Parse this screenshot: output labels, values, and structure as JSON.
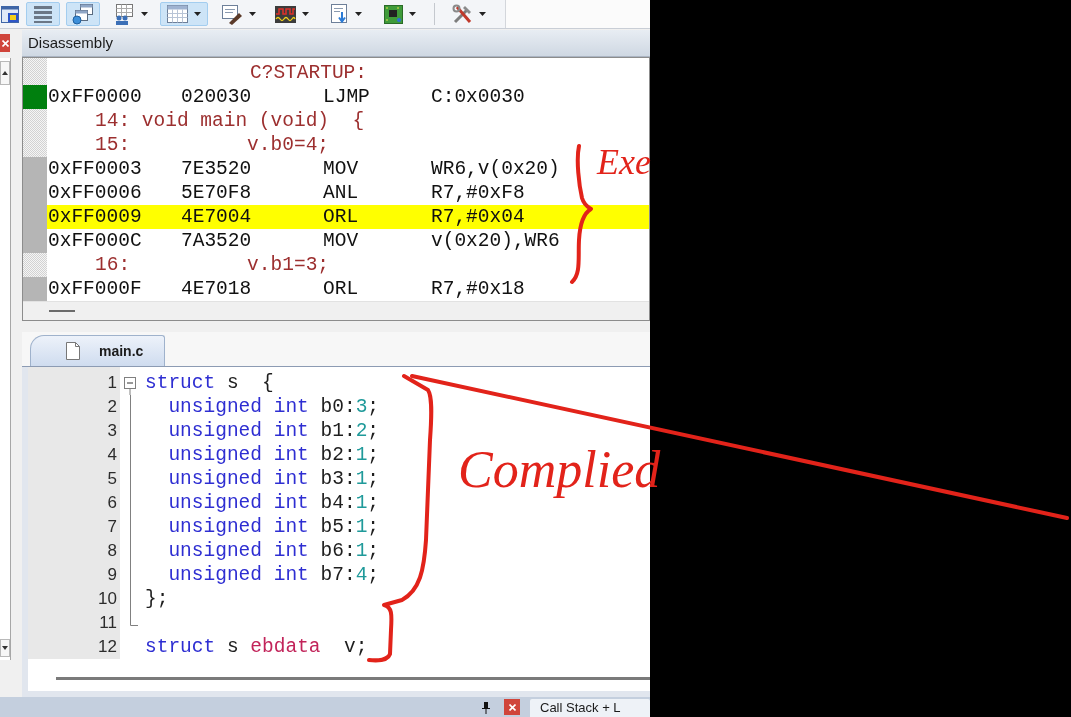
{
  "toolbar": {
    "items": [
      {
        "kind": "button",
        "on": false,
        "dropdown": false
      },
      {
        "kind": "button",
        "on": true,
        "dropdown": false
      },
      {
        "kind": "button",
        "on": true,
        "dropdown": false
      },
      {
        "kind": "button",
        "on": false,
        "dropdown": true
      },
      {
        "kind": "button",
        "on": true,
        "dropdown": true
      },
      {
        "kind": "button",
        "on": false,
        "dropdown": true
      },
      {
        "kind": "button",
        "on": false,
        "dropdown": true
      },
      {
        "kind": "button",
        "on": false,
        "dropdown": true
      },
      {
        "kind": "button",
        "on": false,
        "dropdown": true
      },
      {
        "kind": "separator"
      },
      {
        "kind": "button",
        "on": false,
        "dropdown": true
      }
    ]
  },
  "disassembly": {
    "title": "Disassembly",
    "rows": [
      {
        "kind": "label",
        "text": "C?STARTUP:"
      },
      {
        "kind": "instruction",
        "address": "0xFF0000",
        "opcode": "020030",
        "mnemonic": "LJMP",
        "operands": "C:0x0030",
        "color": "#007f0e",
        "highlighted": false
      },
      {
        "kind": "source",
        "text": "14: void main (void)  {"
      },
      {
        "kind": "source",
        "text": "15:          v.b0=4;"
      },
      {
        "kind": "instruction",
        "address": "0xFF0003",
        "opcode": "7E3520",
        "mnemonic": "MOV",
        "operands": "WR6,v(0x20)",
        "color": "#b5b5b5",
        "highlighted": false
      },
      {
        "kind": "instruction",
        "address": "0xFF0006",
        "opcode": "5E70F8",
        "mnemonic": "ANL",
        "operands": "R7,#0xF8",
        "color": "#b5b5b5",
        "highlighted": false
      },
      {
        "kind": "instruction",
        "address": "0xFF0009",
        "opcode": "4E7004",
        "mnemonic": "ORL",
        "operands": "R7,#0x04",
        "color": "#b5b5b5",
        "highlighted": true
      },
      {
        "kind": "instruction",
        "address": "0xFF000C",
        "opcode": "7A3520",
        "mnemonic": "MOV",
        "operands": "v(0x20),WR6",
        "color": "#b5b5b5",
        "highlighted": false
      },
      {
        "kind": "source",
        "text": "16:          v.b1=3;"
      },
      {
        "kind": "instruction",
        "address": "0xFF000F",
        "opcode": "4E7018",
        "mnemonic": "ORL",
        "operands": "R7,#0x18",
        "color": "#b5b5b5",
        "highlighted": false
      }
    ]
  },
  "editor": {
    "tab": {
      "label": "main.c",
      "selected": true
    },
    "lines": [
      {
        "number": "1",
        "kind": "fold_start",
        "indented": false,
        "tokens": [
          {
            "kind": "keyword",
            "text": "struct"
          },
          {
            "kind": "plain",
            "text": " s  {"
          }
        ]
      },
      {
        "number": "2",
        "kind": "fold_body",
        "indented": true,
        "tokens": [
          {
            "kind": "keyword",
            "text": "unsigned int"
          },
          {
            "kind": "plain",
            "text": " b0:"
          },
          {
            "kind": "number",
            "text": "3"
          },
          {
            "kind": "plain",
            "text": ";"
          }
        ]
      },
      {
        "number": "3",
        "kind": "fold_body",
        "indented": true,
        "tokens": [
          {
            "kind": "keyword",
            "text": "unsigned int"
          },
          {
            "kind": "plain",
            "text": " b1:"
          },
          {
            "kind": "number",
            "text": "2"
          },
          {
            "kind": "plain",
            "text": ";"
          }
        ]
      },
      {
        "number": "4",
        "kind": "fold_body",
        "indented": true,
        "tokens": [
          {
            "kind": "keyword",
            "text": "unsigned int"
          },
          {
            "kind": "plain",
            "text": " b2:"
          },
          {
            "kind": "number",
            "text": "1"
          },
          {
            "kind": "plain",
            "text": ";"
          }
        ]
      },
      {
        "number": "5",
        "kind": "fold_body",
        "indented": true,
        "tokens": [
          {
            "kind": "keyword",
            "text": "unsigned int"
          },
          {
            "kind": "plain",
            "text": " b3:"
          },
          {
            "kind": "number",
            "text": "1"
          },
          {
            "kind": "plain",
            "text": ";"
          }
        ]
      },
      {
        "number": "6",
        "kind": "fold_body",
        "indented": true,
        "tokens": [
          {
            "kind": "keyword",
            "text": "unsigned int"
          },
          {
            "kind": "plain",
            "text": " b4:"
          },
          {
            "kind": "number",
            "text": "1"
          },
          {
            "kind": "plain",
            "text": ";"
          }
        ]
      },
      {
        "number": "7",
        "kind": "fold_body",
        "indented": true,
        "tokens": [
          {
            "kind": "keyword",
            "text": "unsigned int"
          },
          {
            "kind": "plain",
            "text": " b5:"
          },
          {
            "kind": "number",
            "text": "1"
          },
          {
            "kind": "plain",
            "text": ";"
          }
        ]
      },
      {
        "number": "8",
        "kind": "fold_body",
        "indented": true,
        "tokens": [
          {
            "kind": "keyword",
            "text": "unsigned int"
          },
          {
            "kind": "plain",
            "text": " b6:"
          },
          {
            "kind": "number",
            "text": "1"
          },
          {
            "kind": "plain",
            "text": ";"
          }
        ]
      },
      {
        "number": "9",
        "kind": "fold_body",
        "indented": true,
        "tokens": [
          {
            "kind": "keyword",
            "text": "unsigned int"
          },
          {
            "kind": "plain",
            "text": " b7:"
          },
          {
            "kind": "number",
            "text": "4"
          },
          {
            "kind": "plain",
            "text": ";"
          }
        ]
      },
      {
        "number": "10",
        "kind": "fold_body",
        "indented": false,
        "tokens": [
          {
            "kind": "plain",
            "text": "};"
          }
        ]
      },
      {
        "number": "11",
        "kind": "fold_end"
      },
      {
        "number": "12",
        "kind": "plain",
        "indented": false,
        "tokens": [
          {
            "kind": "keyword",
            "text": "struct"
          },
          {
            "kind": "plain",
            "text": " s "
          },
          {
            "kind": "type",
            "text": "ebdata"
          },
          {
            "kind": "plain",
            "text": "  v;"
          }
        ]
      }
    ]
  },
  "bottom_bar": {
    "tab": "Call Stack + L"
  },
  "handwritten_notes": [
    "Exe",
    "Complied"
  ]
}
